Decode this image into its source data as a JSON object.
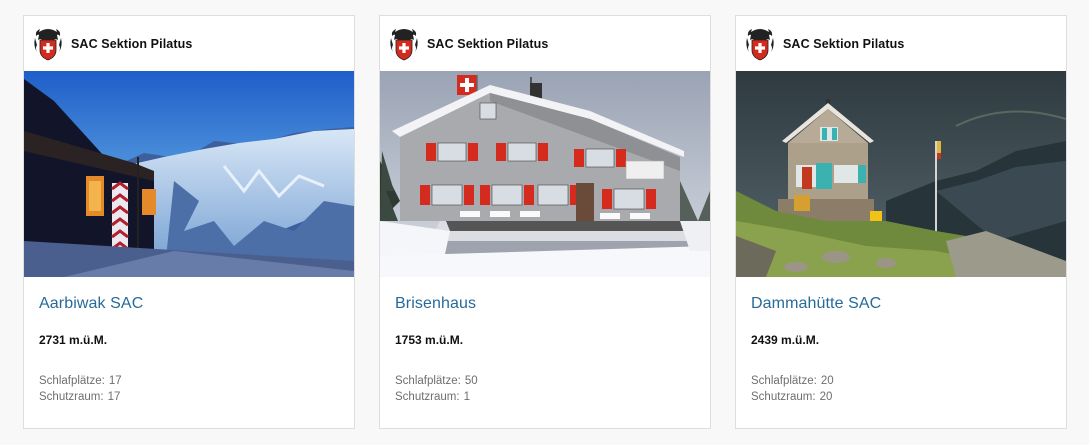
{
  "cards": [
    {
      "section": "SAC Sektion Pilatus",
      "logo_icon": "sac-crest-icon",
      "image_alt": "Aarbiwak hut at dusk with glacier",
      "name": "Aarbiwak SAC",
      "altitude": "2731 m.ü.M.",
      "sleeping_label": "Schlafplätze:",
      "sleeping_value": "17",
      "shelter_label": "Schutzraum:",
      "shelter_value": "17"
    },
    {
      "section": "SAC Sektion Pilatus",
      "logo_icon": "sac-crest-icon",
      "image_alt": "Brisenhaus in snow with Swiss flag",
      "name": "Brisenhaus",
      "altitude": "1753 m.ü.M.",
      "sleeping_label": "Schlafplätze:",
      "sleeping_value": "50",
      "shelter_label": "Schutzraum:",
      "shelter_value": "1"
    },
    {
      "section": "SAC Sektion Pilatus",
      "logo_icon": "sac-crest-icon",
      "image_alt": "Dammahütte stone hut under stormy sky",
      "name": "Dammahütte SAC",
      "altitude": "2439 m.ü.M.",
      "sleeping_label": "Schlafplätze:",
      "sleeping_value": "20",
      "shelter_label": "Schutzraum:",
      "shelter_value": "20"
    }
  ],
  "colors": {
    "link": "#276a9a",
    "swiss_red": "#d52b1e",
    "muted": "#6e6e6e"
  }
}
